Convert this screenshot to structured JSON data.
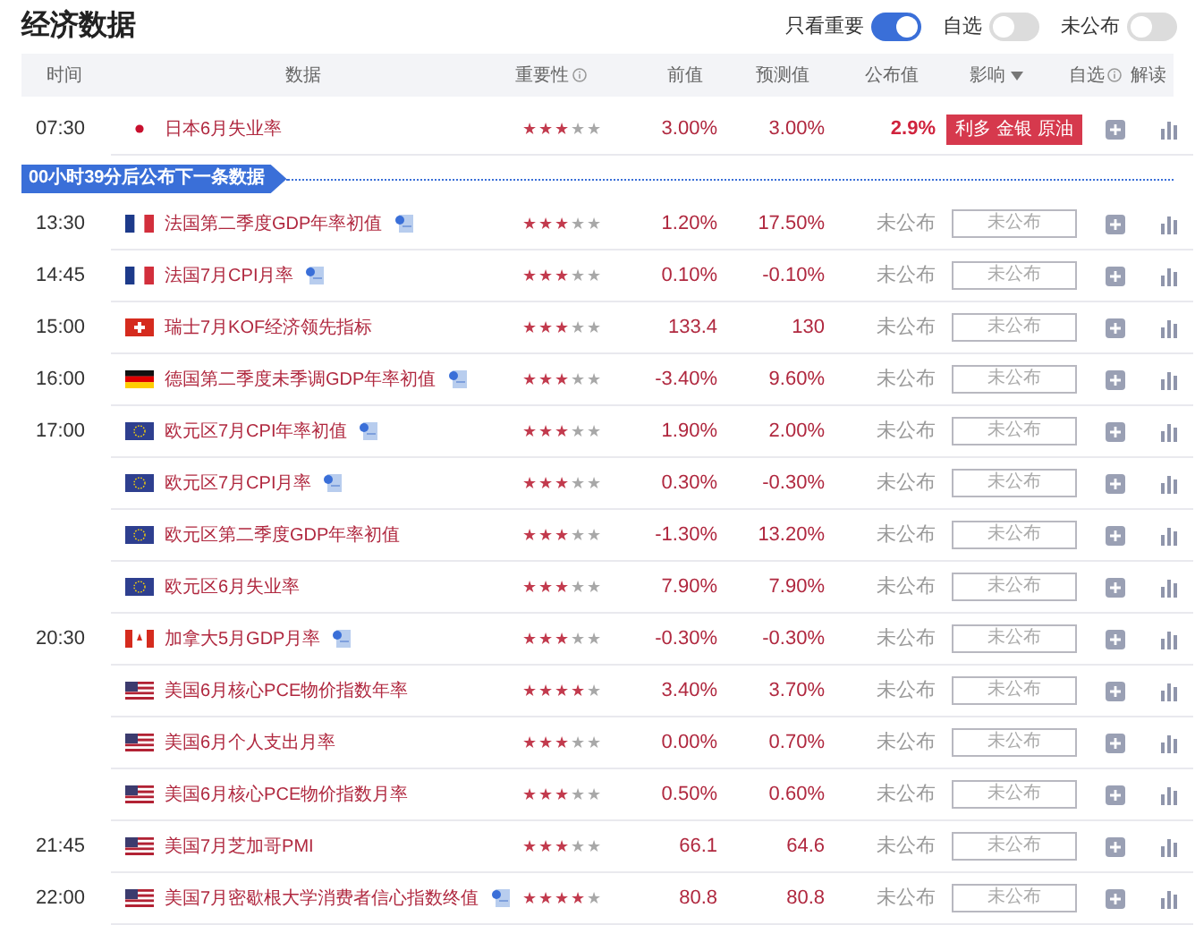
{
  "title": "经济数据",
  "filters": [
    {
      "label": "只看重要",
      "on": true
    },
    {
      "label": "自选",
      "on": false
    },
    {
      "label": "未公布",
      "on": false
    }
  ],
  "columns": [
    "时间",
    "数据",
    "重要性",
    "前值",
    "预测值",
    "公布值",
    "影响",
    "自选",
    "解读"
  ],
  "first_group": {
    "time": "07:30",
    "events": [
      {
        "kind": "jp",
        "name": "日本6月失业率",
        "note": false,
        "stars": 3,
        "previous": "3.00%",
        "forecast": "3.00%",
        "actual": "2.9%",
        "released": true,
        "impact": {
          "kind": "badge",
          "text": "利多 金银 原油"
        }
      }
    ]
  },
  "countdown": "00小时39分后公布下一条数据",
  "groups": [
    {
      "time": "13:30",
      "events": [
        {
          "kind": "fr",
          "name": "法国第二季度GDP年率初值",
          "note": true,
          "stars": 3,
          "previous": "1.20%",
          "forecast": "17.50%",
          "actual": "未公布",
          "released": false,
          "impact": {
            "kind": "pending",
            "text": "未公布"
          }
        }
      ]
    },
    {
      "time": "14:45",
      "events": [
        {
          "kind": "fr",
          "name": "法国7月CPI月率",
          "note": true,
          "stars": 3,
          "previous": "0.10%",
          "forecast": "-0.10%",
          "actual": "未公布",
          "released": false,
          "impact": {
            "kind": "pending",
            "text": "未公布"
          }
        }
      ]
    },
    {
      "time": "15:00",
      "events": [
        {
          "kind": "ch",
          "name": "瑞士7月KOF经济领先指标",
          "note": false,
          "stars": 3,
          "previous": "133.4",
          "forecast": "130",
          "actual": "未公布",
          "released": false,
          "impact": {
            "kind": "pending",
            "text": "未公布"
          }
        }
      ]
    },
    {
      "time": "16:00",
      "events": [
        {
          "kind": "de",
          "name": "德国第二季度未季调GDP年率初值",
          "note": true,
          "stars": 3,
          "previous": "-3.40%",
          "forecast": "9.60%",
          "actual": "未公布",
          "released": false,
          "impact": {
            "kind": "pending",
            "text": "未公布"
          }
        }
      ]
    },
    {
      "time": "17:00",
      "events": [
        {
          "kind": "eu",
          "name": "欧元区7月CPI年率初值",
          "note": true,
          "stars": 3,
          "previous": "1.90%",
          "forecast": "2.00%",
          "actual": "未公布",
          "released": false,
          "impact": {
            "kind": "pending",
            "text": "未公布"
          }
        },
        {
          "kind": "eu",
          "name": "欧元区7月CPI月率",
          "note": true,
          "stars": 3,
          "previous": "0.30%",
          "forecast": "-0.30%",
          "actual": "未公布",
          "released": false,
          "impact": {
            "kind": "pending",
            "text": "未公布"
          }
        },
        {
          "kind": "eu",
          "name": "欧元区第二季度GDP年率初值",
          "note": false,
          "stars": 3,
          "previous": "-1.30%",
          "forecast": "13.20%",
          "actual": "未公布",
          "released": false,
          "impact": {
            "kind": "pending",
            "text": "未公布"
          }
        },
        {
          "kind": "eu",
          "name": "欧元区6月失业率",
          "note": false,
          "stars": 3,
          "previous": "7.90%",
          "forecast": "7.90%",
          "actual": "未公布",
          "released": false,
          "impact": {
            "kind": "pending",
            "text": "未公布"
          }
        }
      ]
    },
    {
      "time": "20:30",
      "events": [
        {
          "kind": "ca",
          "name": "加拿大5月GDP月率",
          "note": true,
          "stars": 3,
          "previous": "-0.30%",
          "forecast": "-0.30%",
          "actual": "未公布",
          "released": false,
          "impact": {
            "kind": "pending",
            "text": "未公布"
          }
        },
        {
          "kind": "us",
          "name": "美国6月核心PCE物价指数年率",
          "note": false,
          "stars": 4,
          "previous": "3.40%",
          "forecast": "3.70%",
          "actual": "未公布",
          "released": false,
          "impact": {
            "kind": "pending",
            "text": "未公布"
          }
        },
        {
          "kind": "us",
          "name": "美国6月个人支出月率",
          "note": false,
          "stars": 3,
          "previous": "0.00%",
          "forecast": "0.70%",
          "actual": "未公布",
          "released": false,
          "impact": {
            "kind": "pending",
            "text": "未公布"
          }
        },
        {
          "kind": "us",
          "name": "美国6月核心PCE物价指数月率",
          "note": false,
          "stars": 3,
          "previous": "0.50%",
          "forecast": "0.60%",
          "actual": "未公布",
          "released": false,
          "impact": {
            "kind": "pending",
            "text": "未公布"
          }
        }
      ]
    },
    {
      "time": "21:45",
      "events": [
        {
          "kind": "us",
          "name": "美国7月芝加哥PMI",
          "note": false,
          "stars": 3,
          "previous": "66.1",
          "forecast": "64.6",
          "actual": "未公布",
          "released": false,
          "impact": {
            "kind": "pending",
            "text": "未公布"
          }
        }
      ]
    },
    {
      "time": "22:00",
      "events": [
        {
          "kind": "us",
          "name": "美国7月密歇根大学消费者信心指数终值",
          "note": true,
          "stars": 4,
          "previous": "80.8",
          "forecast": "80.8",
          "actual": "未公布",
          "released": false,
          "impact": {
            "kind": "pending",
            "text": "未公布"
          }
        }
      ]
    }
  ]
}
